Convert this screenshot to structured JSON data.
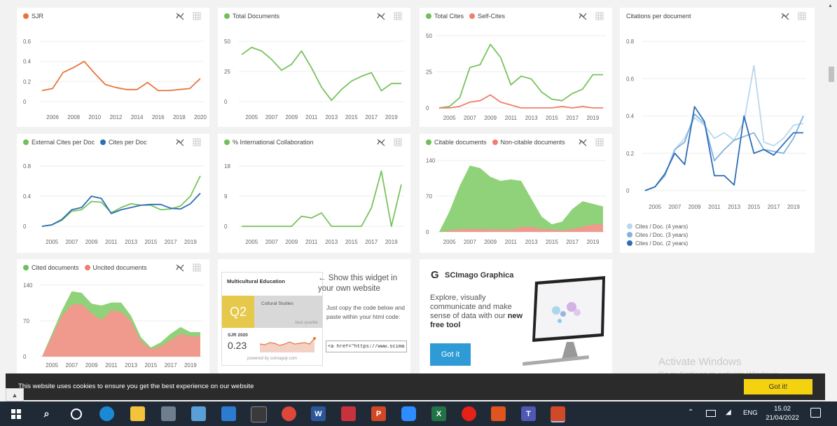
{
  "charts": [
    {
      "id": "sjr",
      "type": "line",
      "legend": [
        {
          "name": "SJR",
          "color": "#e8743b"
        }
      ],
      "x": [
        2005,
        2006,
        2007,
        2008,
        2009,
        2010,
        2011,
        2012,
        2013,
        2014,
        2015,
        2016,
        2017,
        2018,
        2019,
        2020
      ],
      "xticks": [
        "2006",
        "2008",
        "2010",
        "2012",
        "2014",
        "2016",
        "2018",
        "2020"
      ],
      "yticks": [
        "0",
        "0.2",
        "0.4",
        "0.6"
      ],
      "ymax": 0.6,
      "series": [
        {
          "name": "SJR",
          "color": "#e8743b",
          "values": [
            0.11,
            0.13,
            0.29,
            0.34,
            0.4,
            0.28,
            0.17,
            0.14,
            0.12,
            0.12,
            0.19,
            0.11,
            0.11,
            0.12,
            0.13,
            0.23
          ]
        }
      ]
    },
    {
      "id": "totdocs",
      "type": "line",
      "legend": [
        {
          "name": "Total Documents",
          "color": "#6fbf5a"
        }
      ],
      "x": [
        2004,
        2005,
        2006,
        2007,
        2008,
        2009,
        2010,
        2011,
        2012,
        2013,
        2014,
        2015,
        2016,
        2017,
        2018,
        2019,
        2020
      ],
      "xticks": [
        "2005",
        "2007",
        "2009",
        "2011",
        "2013",
        "2015",
        "2017",
        "2019"
      ],
      "yticks": [
        "0",
        "25",
        "50"
      ],
      "ymax": 50,
      "series": [
        {
          "name": "Total Documents",
          "color": "#78c35e",
          "values": [
            39,
            45,
            42,
            35,
            26,
            31,
            42,
            28,
            12,
            1,
            10,
            17,
            21,
            24,
            9,
            15,
            15
          ]
        }
      ]
    },
    {
      "id": "cites",
      "type": "line",
      "legend": [
        {
          "name": "Total Cites",
          "color": "#6fbf5a"
        },
        {
          "name": "Self-Cites",
          "color": "#ef7f6d"
        }
      ],
      "x": [
        2004,
        2005,
        2006,
        2007,
        2008,
        2009,
        2010,
        2011,
        2012,
        2013,
        2014,
        2015,
        2016,
        2017,
        2018,
        2019,
        2020
      ],
      "xticks": [
        "2005",
        "2007",
        "2009",
        "2011",
        "2013",
        "2015",
        "2017",
        "2019"
      ],
      "yticks": [
        "0",
        "25",
        "50"
      ],
      "ymax": 50,
      "series": [
        {
          "name": "Total Cites",
          "color": "#78c35e",
          "values": [
            0,
            1,
            7,
            28,
            30,
            44,
            35,
            16,
            22,
            20,
            11,
            6,
            5,
            10,
            13,
            23,
            23
          ]
        },
        {
          "name": "Self-Cites",
          "color": "#ef7f6d",
          "values": [
            0,
            0,
            1,
            4,
            5,
            9,
            4,
            2,
            0,
            0,
            0,
            0,
            1,
            0,
            1,
            0,
            0
          ]
        }
      ]
    },
    {
      "id": "cpd",
      "type": "line",
      "title": "Citations per document",
      "x": [
        2004,
        2005,
        2006,
        2007,
        2008,
        2009,
        2010,
        2011,
        2012,
        2013,
        2014,
        2015,
        2016,
        2017,
        2018,
        2019,
        2020
      ],
      "xticks": [
        "2005",
        "2007",
        "2009",
        "2011",
        "2013",
        "2015",
        "2017",
        "2019"
      ],
      "yticks": [
        "0",
        "0.2",
        "0.4",
        "0.6",
        "0.8"
      ],
      "ymax": 0.8,
      "legend_bottom": [
        {
          "name": "Cites / Doc. (4 years)",
          "color": "#b9d7ef"
        },
        {
          "name": "Cites / Doc. (3 years)",
          "color": "#7fb3e0"
        },
        {
          "name": "Cites / Doc. (2 years)",
          "color": "#2e6eb5"
        }
      ],
      "series": [
        {
          "name": "Cites / Doc. (4 years)",
          "color": "#b9d7ef",
          "values": [
            0,
            0.02,
            0.08,
            0.22,
            0.28,
            0.39,
            0.35,
            0.28,
            0.31,
            0.27,
            0.37,
            0.67,
            0.26,
            0.24,
            0.28,
            0.35,
            0.36
          ]
        },
        {
          "name": "Cites / Doc. (3 years)",
          "color": "#7fb3e0",
          "values": [
            0,
            0.02,
            0.08,
            0.22,
            0.26,
            0.41,
            0.36,
            0.16,
            0.22,
            0.27,
            0.29,
            0.31,
            0.22,
            0.21,
            0.2,
            0.28,
            0.4
          ]
        },
        {
          "name": "Cites / Doc. (2 years)",
          "color": "#2e6eb5",
          "values": [
            0,
            0.02,
            0.09,
            0.2,
            0.14,
            0.45,
            0.37,
            0.08,
            0.08,
            0.03,
            0.4,
            0.2,
            0.22,
            0.19,
            0.25,
            0.31,
            0.31
          ]
        }
      ]
    },
    {
      "id": "extcites",
      "type": "line",
      "legend": [
        {
          "name": "External Cites per Doc",
          "color": "#6fbf5a"
        },
        {
          "name": "Cites per Doc",
          "color": "#2e6eb5"
        }
      ],
      "x": [
        2004,
        2005,
        2006,
        2007,
        2008,
        2009,
        2010,
        2011,
        2012,
        2013,
        2014,
        2015,
        2016,
        2017,
        2018,
        2019,
        2020
      ],
      "xticks": [
        "2005",
        "2007",
        "2009",
        "2011",
        "2013",
        "2015",
        "2017",
        "2019"
      ],
      "yticks": [
        "0",
        "0.4",
        "0.8"
      ],
      "ymax": 0.8,
      "series": [
        {
          "name": "External Cites per Doc",
          "color": "#78c35e",
          "values": [
            0,
            0.02,
            0.08,
            0.2,
            0.22,
            0.33,
            0.32,
            0.18,
            0.25,
            0.3,
            0.28,
            0.28,
            0.22,
            0.23,
            0.27,
            0.4,
            0.67
          ]
        },
        {
          "name": "Cites per Doc",
          "color": "#2e6eb5",
          "values": [
            0,
            0.02,
            0.09,
            0.22,
            0.25,
            0.4,
            0.37,
            0.17,
            0.22,
            0.25,
            0.28,
            0.29,
            0.29,
            0.24,
            0.23,
            0.3,
            0.44
          ]
        }
      ]
    },
    {
      "id": "intl",
      "type": "line",
      "legend": [
        {
          "name": "% International Collaboration",
          "color": "#6fbf5a"
        }
      ],
      "x": [
        2004,
        2005,
        2006,
        2007,
        2008,
        2009,
        2010,
        2011,
        2012,
        2013,
        2014,
        2015,
        2016,
        2017,
        2018,
        2019,
        2020
      ],
      "xticks": [
        "2005",
        "2007",
        "2009",
        "2011",
        "2013",
        "2015",
        "2017",
        "2019"
      ],
      "yticks": [
        "0",
        "9",
        "18"
      ],
      "ymax": 18,
      "series": [
        {
          "name": "% International Collaboration",
          "color": "#78c35e",
          "values": [
            0,
            0,
            0,
            0,
            0,
            0,
            3,
            2.5,
            4,
            0,
            0,
            0,
            0,
            5.5,
            16.5,
            0,
            12.5
          ]
        }
      ]
    },
    {
      "id": "citable",
      "type": "area",
      "legend": [
        {
          "name": "Citable documents",
          "color": "#6fbf5a"
        },
        {
          "name": "Non-citable documents",
          "color": "#ef7f6d"
        }
      ],
      "x": [
        2004,
        2005,
        2006,
        2007,
        2008,
        2009,
        2010,
        2011,
        2012,
        2013,
        2014,
        2015,
        2016,
        2017,
        2018,
        2019,
        2020
      ],
      "xticks": [
        "2005",
        "2007",
        "2009",
        "2011",
        "2013",
        "2015",
        "2017",
        "2019"
      ],
      "yticks": [
        "0",
        "70",
        "140"
      ],
      "ymax": 140,
      "series": [
        {
          "name": "Citable documents",
          "color": "#8fd27a",
          "values": [
            0,
            40,
            90,
            130,
            125,
            108,
            100,
            103,
            100,
            65,
            30,
            15,
            20,
            45,
            60,
            55,
            50
          ]
        },
        {
          "name": "Non-citable documents",
          "color": "#ef9a8c",
          "values": [
            0,
            3,
            5,
            6,
            6,
            5,
            5,
            5,
            10,
            10,
            6,
            5,
            3,
            6,
            10,
            15,
            15
          ]
        }
      ]
    },
    {
      "id": "cited",
      "type": "area",
      "legend": [
        {
          "name": "Cited documents",
          "color": "#6fbf5a"
        },
        {
          "name": "Uncited documents",
          "color": "#ef7f6d"
        }
      ],
      "x": [
        2004,
        2005,
        2006,
        2007,
        2008,
        2009,
        2010,
        2011,
        2012,
        2013,
        2014,
        2015,
        2016,
        2017,
        2018,
        2019,
        2020
      ],
      "xticks": [
        "2005",
        "2007",
        "2009",
        "2011",
        "2013",
        "2015",
        "2017",
        "2019"
      ],
      "yticks": [
        "0",
        "70",
        "140"
      ],
      "ymax": 140,
      "series": [
        {
          "name": "Cited documents",
          "color": "#8fd27a",
          "values": [
            0,
            45,
            90,
            128,
            125,
            104,
            100,
            106,
            106,
            80,
            38,
            18,
            28,
            45,
            58,
            48,
            48
          ]
        },
        {
          "name": "Uncited documents",
          "color": "#ef9a8c",
          "values": [
            0,
            40,
            80,
            102,
            103,
            85,
            72,
            90,
            88,
            70,
            30,
            15,
            20,
            32,
            45,
            40,
            40
          ]
        }
      ]
    }
  ],
  "widget": {
    "title": "Multicultural Education",
    "quartile": "Q2",
    "category": "Cultural Studies",
    "best": "best quartile",
    "sjr_label": "SJR 2020",
    "sjr_value": "0.23",
    "powered": "powered by scimagojr.com",
    "arrow_text": "← Show this widget in your own website",
    "copy_text": "Just copy the code below and paste within your html code:",
    "code_value": "<a href=\"https://www.scimag",
    "spark": [
      0.5,
      0.45,
      0.6,
      0.55,
      0.4,
      0.5,
      0.65,
      0.5,
      0.55,
      0.6,
      0.5,
      0.9
    ]
  },
  "graphica": {
    "brand": "SCImago Graphica",
    "text": "Explore, visually communicate and make sense of data with our",
    "new_text": "new free tool",
    "button": "Got it"
  },
  "cookie": {
    "text": "This website uses cookies to ensure you get the best experience on our website",
    "button": "Got it!"
  },
  "watermark": {
    "line1": "Activate Windows",
    "line2": "Go to Settings to activate Windows."
  },
  "taskbar": {
    "lang": "ENG",
    "time": "15.02",
    "date": "21/04/2022"
  }
}
